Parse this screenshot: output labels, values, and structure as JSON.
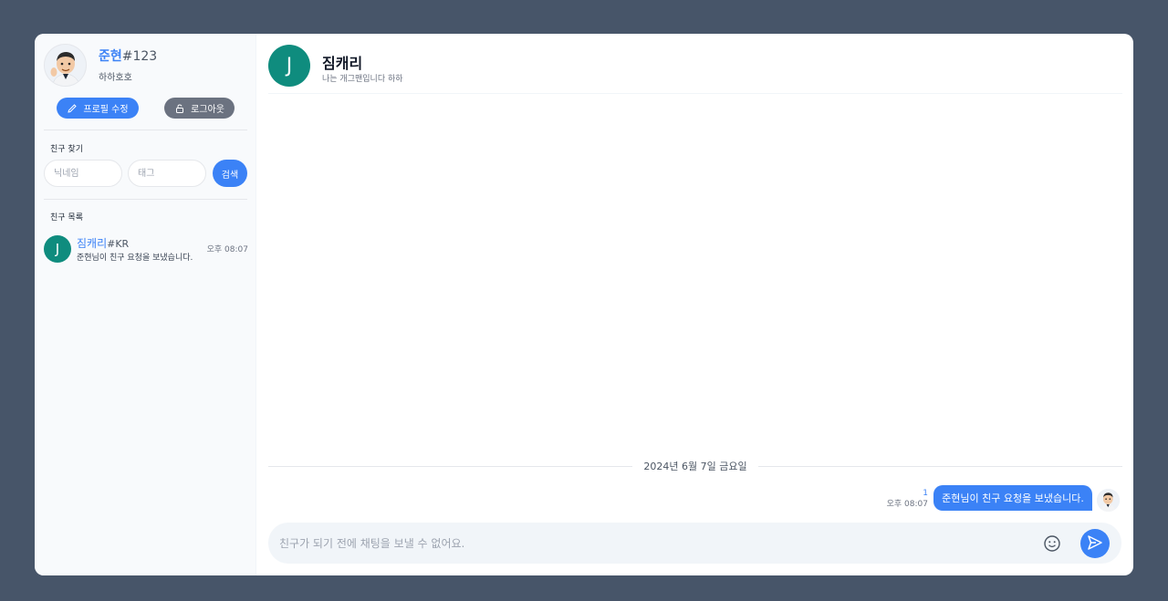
{
  "profile": {
    "nickname": "준현",
    "tag": "#123",
    "status": "하하호호",
    "edit_label": "프로필 수정",
    "logout_label": "로그아웃"
  },
  "search": {
    "section_label": "친구 찾기",
    "nickname_placeholder": "닉네임",
    "tag_placeholder": "태그",
    "button_label": "검색"
  },
  "friends": {
    "section_label": "친구 목록",
    "items": [
      {
        "initial": "J",
        "nickname": "짐캐리",
        "tag": "#KR",
        "last_message": "준현님이 친구 요청을 보냈습니다.",
        "time": "오후 08:07"
      }
    ]
  },
  "chat": {
    "initial": "J",
    "title": "짐캐리",
    "subtitle": "나는 개그맨입니다 하하",
    "date_separator": "2024년 6월 7일 금요일",
    "messages": [
      {
        "text": "준현님이 친구 요청을 보냈습니다.",
        "unread_count": "1",
        "time": "오후 08:07",
        "outgoing": true
      }
    ],
    "composer_placeholder": "친구가 되기 전에 채팅을 보낼 수 없어요."
  },
  "colors": {
    "background": "#475569",
    "accent": "#3b82f6",
    "avatar_teal": "#0f8c7e",
    "muted_button": "#6b7280"
  },
  "icons": [
    "pencil-icon",
    "lock-icon",
    "emoji-icon",
    "send-icon"
  ]
}
